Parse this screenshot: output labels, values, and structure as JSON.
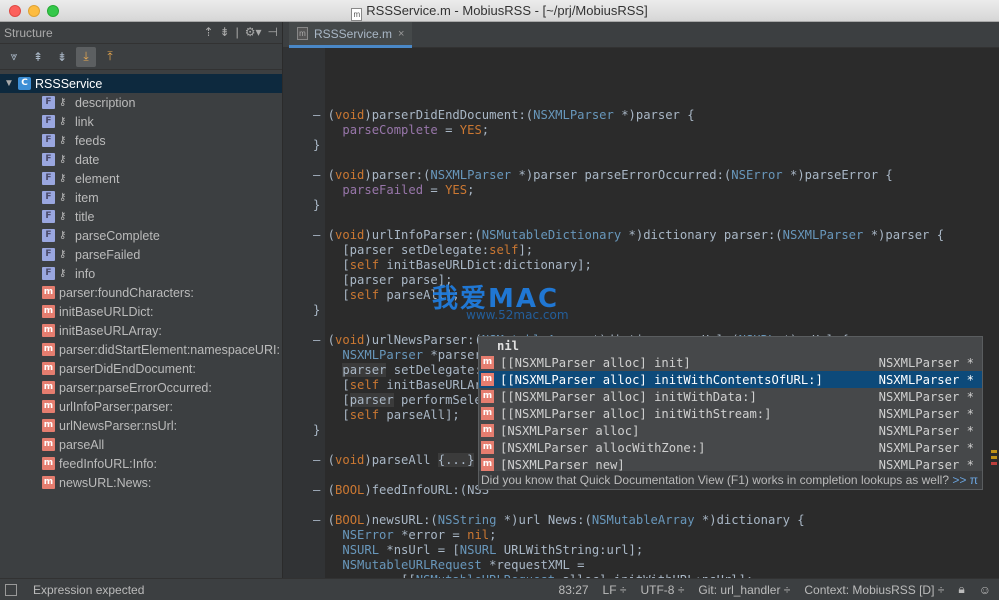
{
  "window": {
    "title": "RSSService.m - MobiusRSS - [~/prj/MobiusRSS]",
    "file_icon": "m"
  },
  "structure": {
    "title": "Structure",
    "root": {
      "label": "RSSService",
      "icon": "C"
    },
    "fields": [
      "description",
      "link",
      "feeds",
      "date",
      "element",
      "item",
      "title",
      "parseComplete",
      "parseFailed",
      "info"
    ],
    "methods": [
      "parser:foundCharacters:",
      "initBaseURLDict:",
      "initBaseURLArray:",
      "parser:didStartElement:namespaceURI:",
      "parserDidEndDocument:",
      "parser:parseErrorOccurred:",
      "urlInfoParser:parser:",
      "urlNewsParser:nsUrl:",
      "parseAll",
      "feedInfoURL:Info:",
      "newsURL:News:"
    ],
    "field_icon": "F",
    "method_icon": "m"
  },
  "editor": {
    "tab_label": "RSSService.m",
    "tab_icon": "m"
  },
  "completion": {
    "header": "nil",
    "items": [
      {
        "text": "[[NSXMLParser alloc] init]",
        "type": "NSXMLParser *"
      },
      {
        "text": "[[NSXMLParser alloc] initWithContentsOfURL:]",
        "type": "NSXMLParser *"
      },
      {
        "text": "[[NSXMLParser alloc] initWithData:]",
        "type": "NSXMLParser *"
      },
      {
        "text": "[[NSXMLParser alloc] initWithStream:]",
        "type": "NSXMLParser *"
      },
      {
        "text": "[NSXMLParser alloc]",
        "type": "NSXMLParser *"
      },
      {
        "text": "[NSXMLParser allocWithZone:]",
        "type": "NSXMLParser *"
      },
      {
        "text": "[NSXMLParser new]",
        "type": "NSXMLParser *"
      }
    ],
    "selected_index": 1,
    "hint": "Did you know that Quick Documentation View (F1) works in completion lookups as well?",
    "hint_link": ">>",
    "hint_pi": "π"
  },
  "watermark": {
    "text": "我爱MAC",
    "sub": "www.52mac.com"
  },
  "status": {
    "message": "Expression expected",
    "position": "83:27",
    "line_sep": "LF ÷",
    "encoding": "UTF-8 ÷",
    "git": "Git: url_handler ÷",
    "context": "Context: MobiusRSS [D] ÷"
  }
}
